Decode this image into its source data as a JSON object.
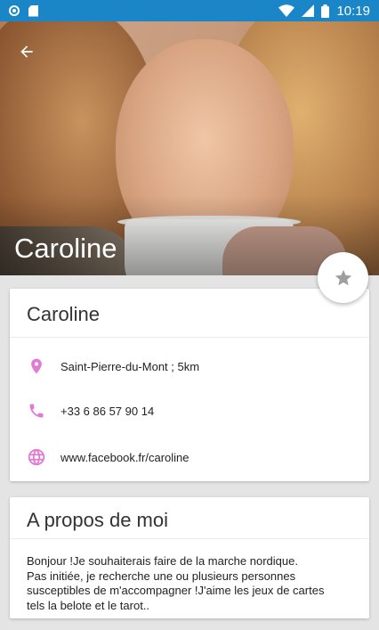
{
  "status_bar": {
    "time": "10:19",
    "icons": [
      "notification-circle-icon",
      "sd-card-icon",
      "wifi-icon",
      "signal-icon",
      "battery-icon"
    ]
  },
  "header": {
    "title": "Caroline",
    "back_icon": "arrow-back-icon"
  },
  "fab": {
    "icon": "star-icon"
  },
  "contact_card": {
    "name": "Caroline",
    "location": "Saint-Pierre-du-Mont ; 5km",
    "phone": "+33 6 86 57 90 14",
    "website": "www.facebook.fr/caroline",
    "icon_color": "#e07ad3"
  },
  "about_card": {
    "title": "A propos de moi",
    "lines": [
      "Bonjour !Je souhaiterais faire de la marche nordique.",
      "Pas initiée, je recherche une ou plusieurs personnes",
      "susceptibles de m'accompagner !J'aime les jeux de cartes",
      "tels la belote et le tarot.."
    ]
  },
  "colors": {
    "status_bar": "#1b86c7",
    "accent": "#e07ad3",
    "background": "#e4e4e4"
  }
}
